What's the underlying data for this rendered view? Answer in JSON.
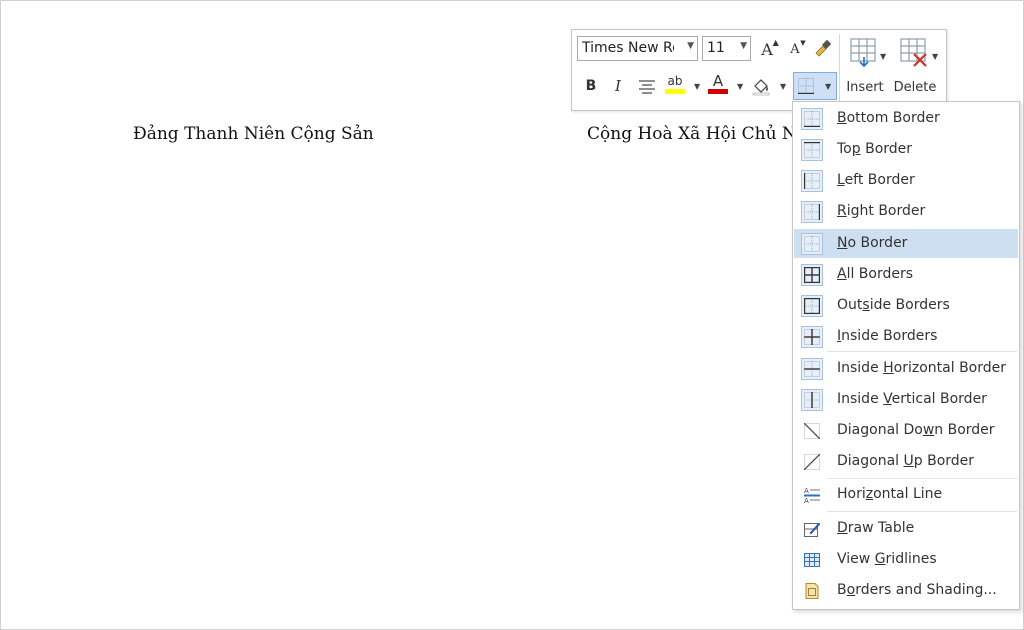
{
  "document": {
    "left_heading": "Đảng Thanh Niên Cộng Sản",
    "right_heading": "Cộng Hoà Xã Hội Chủ Ngh"
  },
  "mini_toolbar": {
    "font_name": "Times New Roman",
    "font_size": "11",
    "insert_label": "Insert",
    "delete_label": "Delete",
    "bold_glyph": "B",
    "italic_glyph": "I",
    "grow_font_glyph": "A",
    "shrink_font_glyph": "A",
    "highlight_glyph": "ab",
    "font_color_glyph": "A",
    "highlight_color": "#ffff00",
    "font_color": "#d00000"
  },
  "borders_menu": {
    "items": [
      {
        "pre": "",
        "key": "B",
        "post": "ottom Border",
        "icon": "bottom-border-icon"
      },
      {
        "pre": "To",
        "key": "p",
        "post": " Border",
        "icon": "top-border-icon"
      },
      {
        "pre": "",
        "key": "L",
        "post": "eft Border",
        "icon": "left-border-icon"
      },
      {
        "pre": "",
        "key": "R",
        "post": "ight Border",
        "icon": "right-border-icon"
      },
      {
        "pre": "",
        "key": "N",
        "post": "o Border",
        "icon": "no-border-icon"
      },
      {
        "pre": "",
        "key": "A",
        "post": "ll Borders",
        "icon": "all-borders-icon"
      },
      {
        "pre": "Out",
        "key": "s",
        "post": "ide Borders",
        "icon": "outside-borders-icon"
      },
      {
        "pre": "",
        "key": "I",
        "post": "nside Borders",
        "icon": "inside-borders-icon"
      },
      {
        "pre": "Inside ",
        "key": "H",
        "post": "orizontal Border",
        "icon": "inside-horizontal-border-icon"
      },
      {
        "pre": "Inside ",
        "key": "V",
        "post": "ertical Border",
        "icon": "inside-vertical-border-icon"
      },
      {
        "pre": "Diagonal Do",
        "key": "w",
        "post": "n Border",
        "icon": "diagonal-down-border-icon"
      },
      {
        "pre": "Diagonal ",
        "key": "U",
        "post": "p Border",
        "icon": "diagonal-up-border-icon"
      },
      {
        "pre": "Hori",
        "key": "z",
        "post": "ontal Line",
        "icon": "horizontal-line-icon"
      },
      {
        "pre": "",
        "key": "D",
        "post": "raw Table",
        "icon": "draw-table-icon"
      },
      {
        "pre": "View ",
        "key": "G",
        "post": "ridlines",
        "icon": "view-gridlines-icon"
      },
      {
        "pre": "B",
        "key": "o",
        "post": "rders and Shading...",
        "icon": "borders-shading-icon"
      }
    ],
    "highlighted_index": 4
  }
}
